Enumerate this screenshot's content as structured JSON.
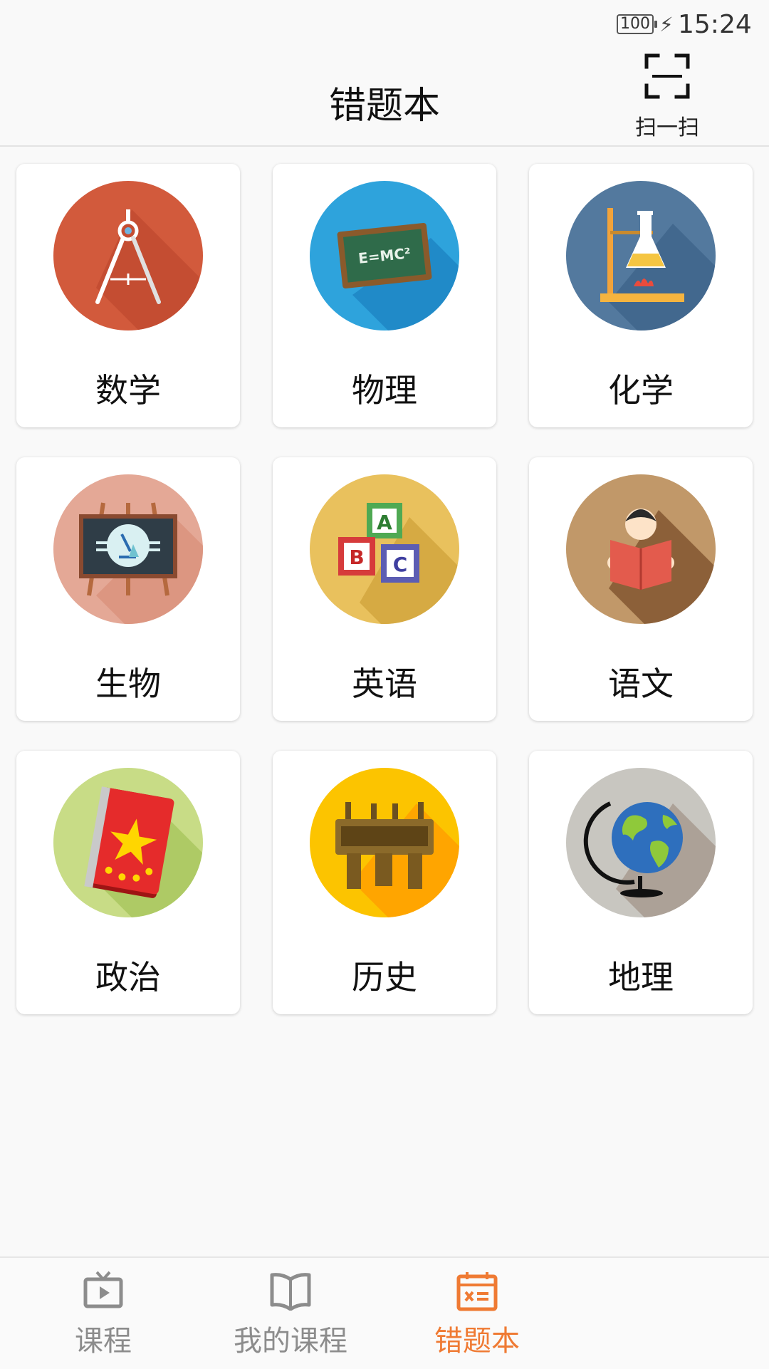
{
  "status": {
    "battery": "100",
    "time": "15:24"
  },
  "header": {
    "title": "错题本",
    "scan_label": "扫一扫"
  },
  "subjects": [
    {
      "label": "数学",
      "icon": "compass-icon",
      "color": "#d25a3c"
    },
    {
      "label": "物理",
      "icon": "chalkboard-emc2-icon",
      "color": "#2ea3dc"
    },
    {
      "label": "化学",
      "icon": "flask-burner-icon",
      "color": "#53799e"
    },
    {
      "label": "生物",
      "icon": "microscope-easel-icon",
      "color": "#e4a896"
    },
    {
      "label": "英语",
      "icon": "abc-blocks-icon",
      "color": "#e9c15d"
    },
    {
      "label": "语文",
      "icon": "reading-person-icon",
      "color": "#c19869"
    },
    {
      "label": "政治",
      "icon": "red-star-book-icon",
      "color": "#c8dc86"
    },
    {
      "label": "历史",
      "icon": "bronze-ding-icon",
      "color": "#fcc400"
    },
    {
      "label": "地理",
      "icon": "globe-icon",
      "color": "#c8c6c0"
    }
  ],
  "tabbar": {
    "items": [
      {
        "label": "课程",
        "icon": "tv-play-icon",
        "active": false
      },
      {
        "label": "我的课程",
        "icon": "open-book-icon",
        "active": false
      },
      {
        "label": "错题本",
        "icon": "calendar-x-icon",
        "active": true
      }
    ],
    "active_color": "#ef7a33",
    "inactive_color": "#8c8c8c"
  }
}
